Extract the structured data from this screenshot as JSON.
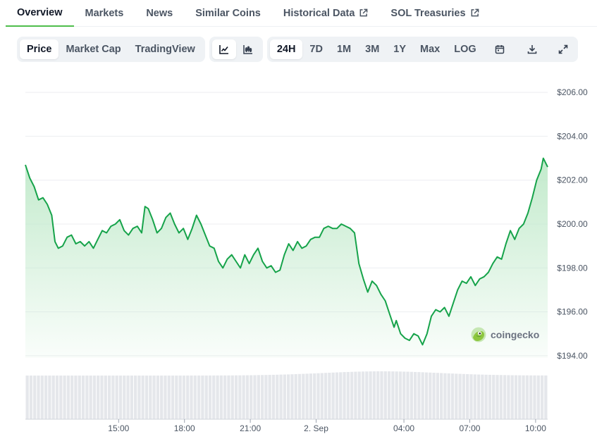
{
  "tabs": [
    {
      "label": "Overview"
    },
    {
      "label": "Markets"
    },
    {
      "label": "News"
    },
    {
      "label": "Similar Coins"
    },
    {
      "label": "Historical Data"
    },
    {
      "label": "SOL Treasuries"
    }
  ],
  "toolbar": {
    "view_buttons": [
      "Price",
      "Market Cap",
      "TradingView"
    ],
    "chart_icons": [
      "line-chart-icon",
      "candlestick-chart-icon"
    ],
    "range_buttons": [
      "24H",
      "7D",
      "1M",
      "3M",
      "1Y",
      "Max",
      "LOG"
    ],
    "action_icons": [
      "calendar-icon",
      "download-icon",
      "fullscreen-icon"
    ],
    "active_view": "Price",
    "active_range": "24H"
  },
  "watermark": {
    "text": "coingecko"
  },
  "colors": {
    "line": "#16a34a",
    "fill_top": "#bfe9c9",
    "accent_tab": "#4ebd4b"
  },
  "chart_data": {
    "type": "area",
    "y_ticks": [
      "$194.00",
      "$196.00",
      "$198.00",
      "$200.00",
      "$202.00",
      "$204.00",
      "$206.00"
    ],
    "ylim": [
      193.9,
      206.1
    ],
    "x_ticks": [
      "15:00",
      "18:00",
      "21:00",
      "2. Sep",
      "04:00",
      "07:00",
      "10:00"
    ],
    "x_tick_hours": [
      4.25,
      7.25,
      10.25,
      13.25,
      17.25,
      20.25,
      23.25
    ],
    "xlim": [
      0,
      23.8
    ],
    "grid": true,
    "series": [
      {
        "values": [
          [
            0.0,
            202.7
          ],
          [
            0.2,
            202.1
          ],
          [
            0.4,
            201.7
          ],
          [
            0.6,
            201.1
          ],
          [
            0.8,
            201.2
          ],
          [
            1.0,
            200.9
          ],
          [
            1.2,
            200.4
          ],
          [
            1.35,
            199.2
          ],
          [
            1.5,
            198.9
          ],
          [
            1.7,
            199.0
          ],
          [
            1.9,
            199.4
          ],
          [
            2.1,
            199.5
          ],
          [
            2.3,
            199.1
          ],
          [
            2.5,
            199.2
          ],
          [
            2.7,
            199.0
          ],
          [
            2.9,
            199.2
          ],
          [
            3.1,
            198.9
          ],
          [
            3.3,
            199.3
          ],
          [
            3.5,
            199.7
          ],
          [
            3.7,
            199.6
          ],
          [
            3.9,
            199.9
          ],
          [
            4.1,
            200.0
          ],
          [
            4.3,
            200.2
          ],
          [
            4.5,
            199.7
          ],
          [
            4.7,
            199.5
          ],
          [
            4.9,
            199.8
          ],
          [
            5.1,
            199.9
          ],
          [
            5.3,
            199.6
          ],
          [
            5.45,
            200.8
          ],
          [
            5.6,
            200.7
          ],
          [
            5.8,
            200.2
          ],
          [
            6.0,
            199.6
          ],
          [
            6.2,
            199.8
          ],
          [
            6.4,
            200.3
          ],
          [
            6.6,
            200.5
          ],
          [
            6.8,
            200.0
          ],
          [
            7.0,
            199.6
          ],
          [
            7.2,
            199.8
          ],
          [
            7.4,
            199.3
          ],
          [
            7.6,
            199.8
          ],
          [
            7.8,
            200.4
          ],
          [
            8.0,
            200.0
          ],
          [
            8.2,
            199.5
          ],
          [
            8.4,
            199.0
          ],
          [
            8.6,
            198.9
          ],
          [
            8.8,
            198.3
          ],
          [
            9.0,
            198.0
          ],
          [
            9.2,
            198.4
          ],
          [
            9.4,
            198.6
          ],
          [
            9.6,
            198.3
          ],
          [
            9.8,
            198.0
          ],
          [
            10.0,
            198.6
          ],
          [
            10.2,
            198.2
          ],
          [
            10.4,
            198.6
          ],
          [
            10.6,
            198.9
          ],
          [
            10.8,
            198.3
          ],
          [
            11.0,
            198.0
          ],
          [
            11.2,
            198.1
          ],
          [
            11.4,
            197.8
          ],
          [
            11.6,
            197.9
          ],
          [
            11.8,
            198.6
          ],
          [
            12.0,
            199.1
          ],
          [
            12.2,
            198.8
          ],
          [
            12.4,
            199.2
          ],
          [
            12.6,
            198.9
          ],
          [
            12.8,
            199.0
          ],
          [
            13.0,
            199.3
          ],
          [
            13.2,
            199.4
          ],
          [
            13.4,
            199.4
          ],
          [
            13.6,
            199.8
          ],
          [
            13.8,
            199.9
          ],
          [
            14.0,
            199.8
          ],
          [
            14.2,
            199.8
          ],
          [
            14.4,
            200.0
          ],
          [
            14.6,
            199.9
          ],
          [
            14.8,
            199.8
          ],
          [
            15.0,
            199.6
          ],
          [
            15.2,
            198.2
          ],
          [
            15.4,
            197.5
          ],
          [
            15.6,
            196.9
          ],
          [
            15.8,
            197.4
          ],
          [
            16.0,
            197.2
          ],
          [
            16.2,
            196.8
          ],
          [
            16.4,
            196.5
          ],
          [
            16.6,
            195.9
          ],
          [
            16.8,
            195.3
          ],
          [
            16.9,
            195.6
          ],
          [
            17.1,
            195.0
          ],
          [
            17.3,
            194.8
          ],
          [
            17.5,
            194.7
          ],
          [
            17.7,
            195.0
          ],
          [
            17.9,
            194.9
          ],
          [
            18.1,
            194.5
          ],
          [
            18.3,
            195.0
          ],
          [
            18.5,
            195.8
          ],
          [
            18.7,
            196.1
          ],
          [
            18.9,
            196.0
          ],
          [
            19.1,
            196.2
          ],
          [
            19.3,
            195.8
          ],
          [
            19.5,
            196.4
          ],
          [
            19.7,
            197.0
          ],
          [
            19.9,
            197.4
          ],
          [
            20.1,
            197.3
          ],
          [
            20.3,
            197.6
          ],
          [
            20.5,
            197.2
          ],
          [
            20.7,
            197.5
          ],
          [
            20.9,
            197.6
          ],
          [
            21.1,
            197.8
          ],
          [
            21.3,
            198.2
          ],
          [
            21.5,
            198.5
          ],
          [
            21.7,
            198.4
          ],
          [
            21.9,
            199.1
          ],
          [
            22.1,
            199.7
          ],
          [
            22.3,
            199.3
          ],
          [
            22.5,
            199.8
          ],
          [
            22.7,
            200.0
          ],
          [
            22.9,
            200.5
          ],
          [
            23.1,
            201.2
          ],
          [
            23.3,
            202.0
          ],
          [
            23.5,
            202.5
          ],
          [
            23.6,
            203.0
          ],
          [
            23.8,
            202.6
          ]
        ]
      }
    ],
    "volume": true
  }
}
